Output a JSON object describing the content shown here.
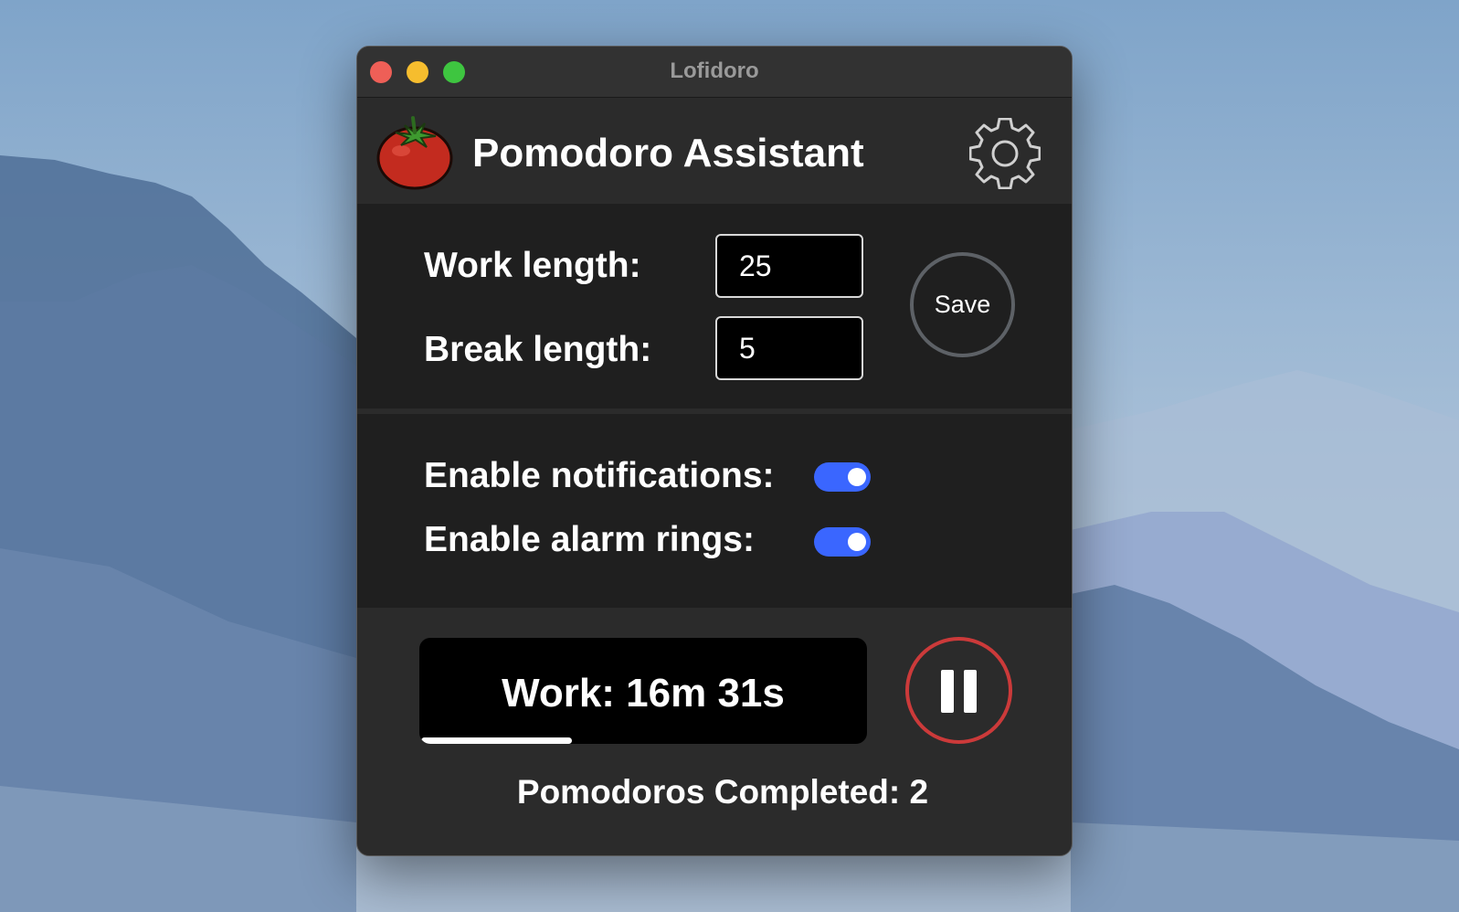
{
  "window": {
    "title": "Lofidoro"
  },
  "header": {
    "app_title": "Pomodoro Assistant",
    "logo_icon": "tomato-icon",
    "settings_icon": "gear-icon"
  },
  "lengths": {
    "work_label": "Work length:",
    "work_value": "25",
    "break_label": "Break length:",
    "break_value": "5",
    "save_label": "Save"
  },
  "toggles": {
    "notifications_label": "Enable notifications:",
    "notifications_on": true,
    "alarm_label": "Enable alarm rings:",
    "alarm_on": true,
    "accent_color": "#3a66ff"
  },
  "timer": {
    "text": "Work: 16m 31s",
    "progress": 0.34,
    "pause_icon": "pause-icon",
    "pause_color": "#cc3a3a"
  },
  "stats": {
    "completed_text": "Pomodoros Completed: 2"
  }
}
